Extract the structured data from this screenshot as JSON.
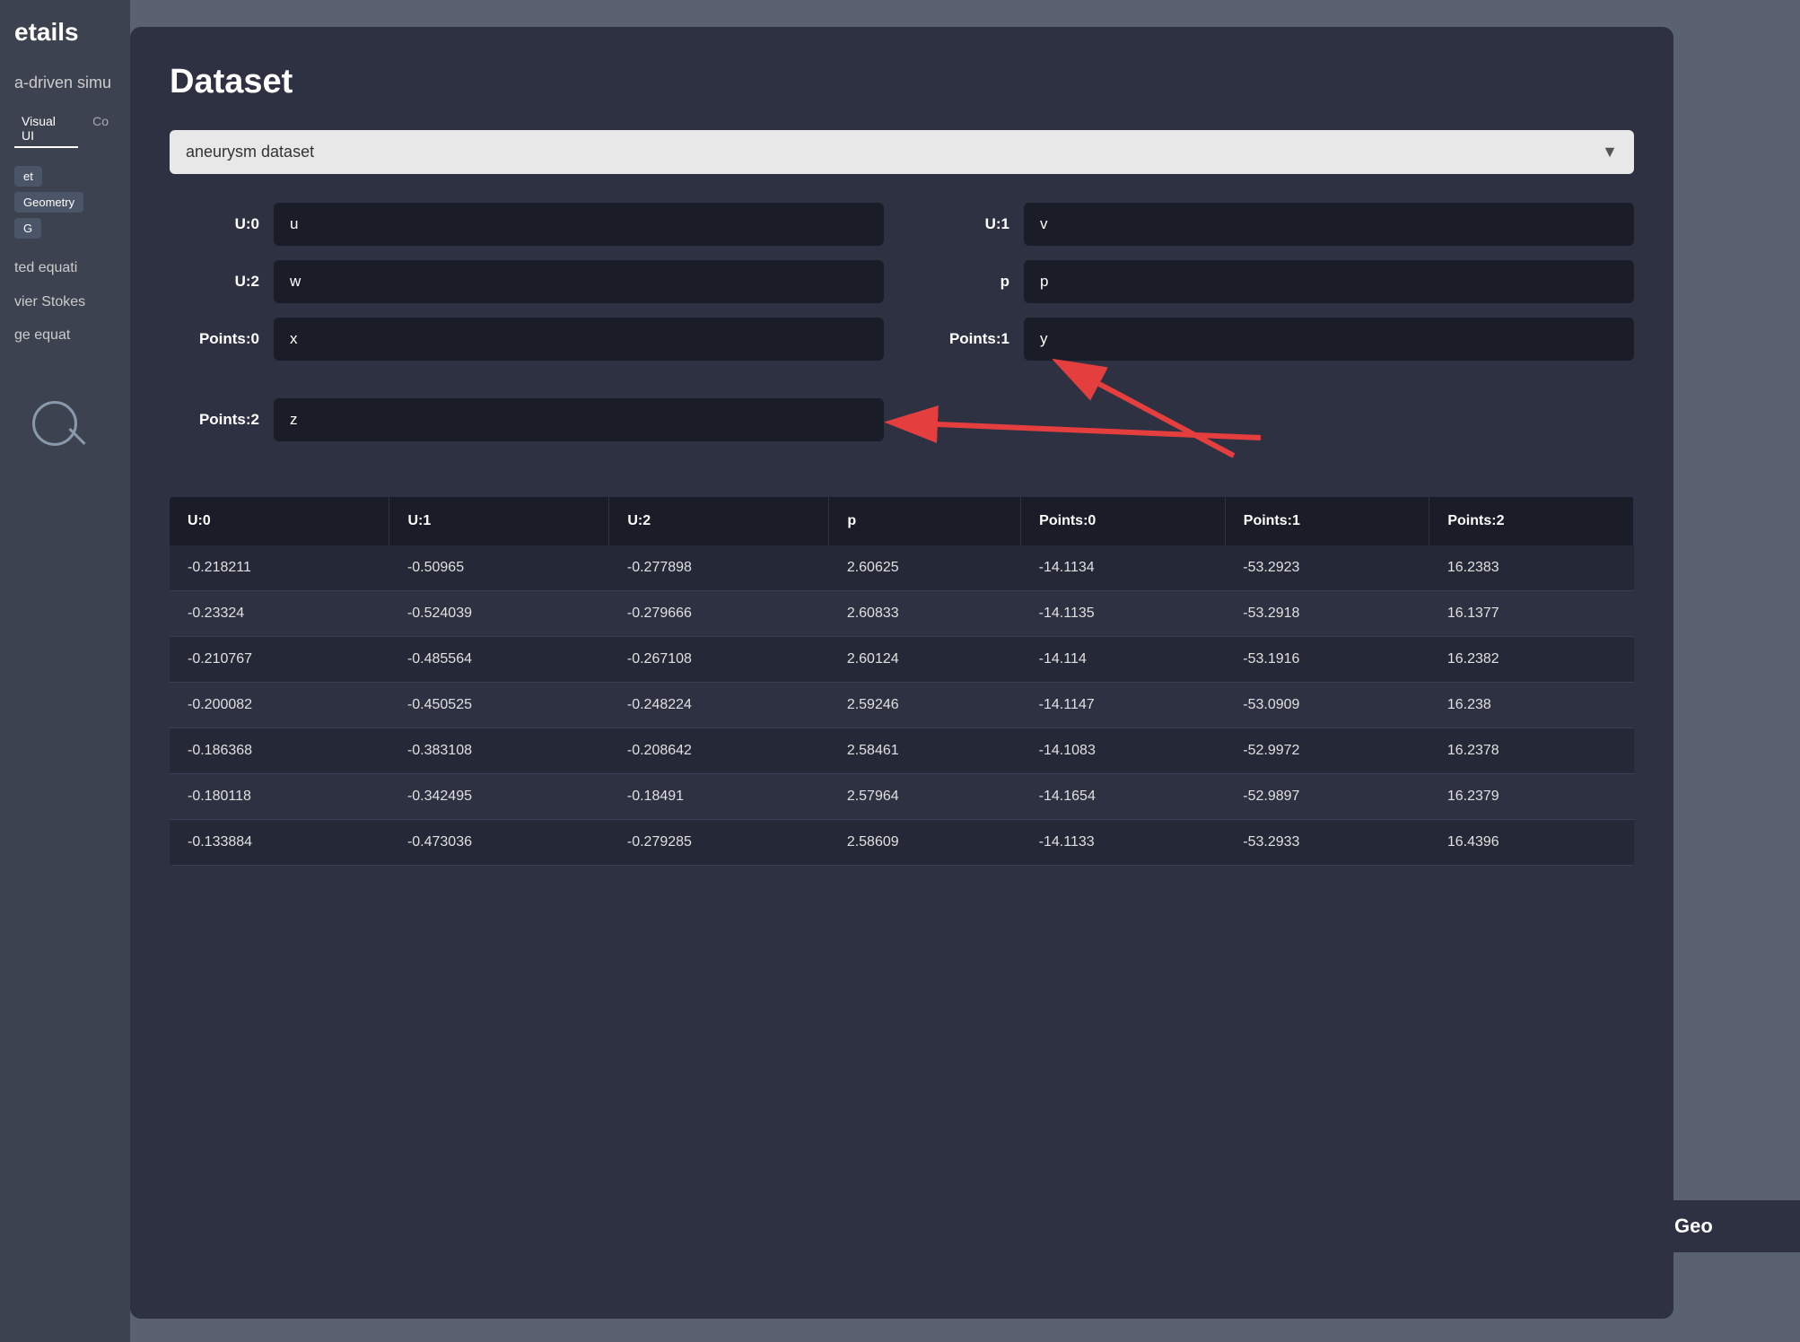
{
  "background": {
    "color": "#5a6170"
  },
  "leftSidebar": {
    "title": "etails",
    "subtitle": "a-driven simu",
    "tabs": [
      {
        "label": "Visual UI",
        "active": true
      },
      {
        "label": "Co",
        "active": false
      }
    ],
    "chips": [
      {
        "label": "et"
      },
      {
        "label": "Geometry"
      },
      {
        "label": "G"
      }
    ],
    "textLines": [
      "ted equati",
      "vier Stokes",
      "",
      "ge equat"
    ]
  },
  "modal": {
    "title": "Dataset",
    "datasetDropdown": {
      "value": "aneurysm dataset",
      "placeholder": "aneurysm dataset"
    },
    "fieldMappings": [
      {
        "label": "U:0",
        "value": "u",
        "side": "left"
      },
      {
        "label": "U:1",
        "value": "v",
        "side": "right"
      },
      {
        "label": "U:2",
        "value": "w",
        "side": "left"
      },
      {
        "label": "p",
        "value": "p",
        "side": "right"
      },
      {
        "label": "Points:0",
        "value": "x",
        "side": "left"
      },
      {
        "label": "Points:1",
        "value": "y",
        "side": "right"
      },
      {
        "label": "Points:2",
        "value": "z",
        "side": "left"
      }
    ],
    "tableHeaders": [
      "U:0",
      "U:1",
      "U:2",
      "p",
      "Points:0",
      "Points:1",
      "Points:2"
    ],
    "tableRows": [
      [
        "-0.218211",
        "-0.50965",
        "-0.277898",
        "2.60625",
        "-14.1134",
        "-53.2923",
        "16.2383"
      ],
      [
        "-0.23324",
        "-0.524039",
        "-0.279666",
        "2.60833",
        "-14.1135",
        "-53.2918",
        "16.1377"
      ],
      [
        "-0.210767",
        "-0.485564",
        "-0.267108",
        "2.60124",
        "-14.114",
        "-53.1916",
        "16.2382"
      ],
      [
        "-0.200082",
        "-0.450525",
        "-0.248224",
        "2.59246",
        "-14.1147",
        "-53.0909",
        "16.238"
      ],
      [
        "-0.186368",
        "-0.383108",
        "-0.208642",
        "2.58461",
        "-14.1083",
        "-52.9972",
        "16.2378"
      ],
      [
        "-0.180118",
        "-0.342495",
        "-0.18491",
        "2.57964",
        "-14.1654",
        "-52.9897",
        "16.2379"
      ],
      [
        "-0.133884",
        "-0.473036",
        "-0.279285",
        "2.58609",
        "-14.1133",
        "-53.2933",
        "16.4396"
      ]
    ]
  },
  "rightPartial": {
    "text": "Geo"
  },
  "icons": {
    "search": "search-icon",
    "dropdownArrow": "▼"
  }
}
